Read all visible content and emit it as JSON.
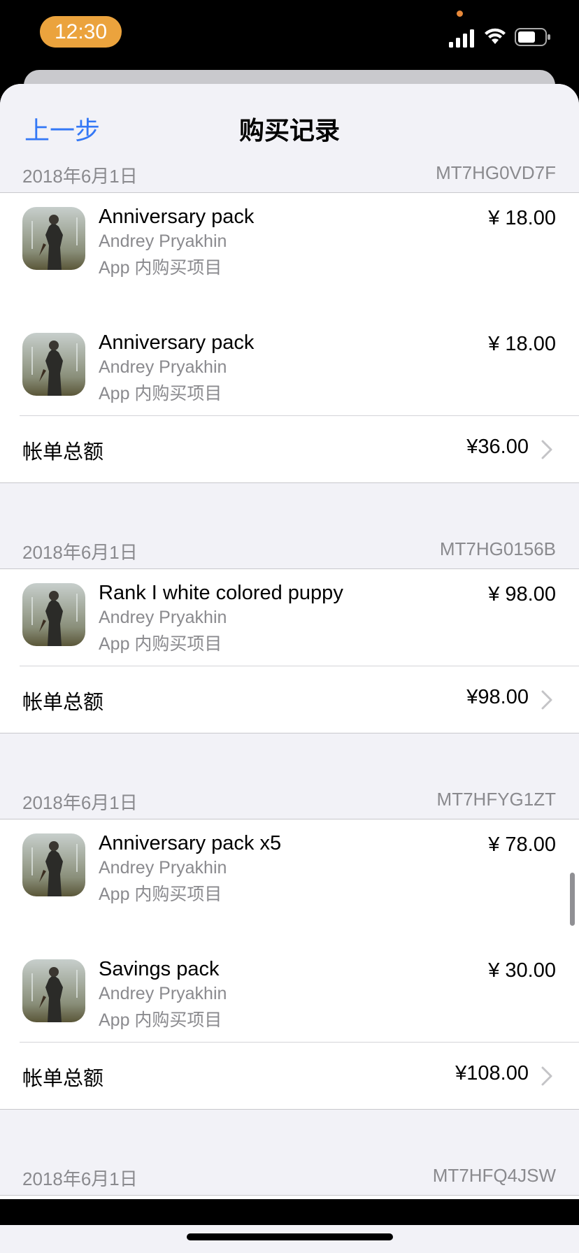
{
  "status_bar": {
    "time": "12:30"
  },
  "nav": {
    "back_label": "上一步",
    "title": "购买记录"
  },
  "icons": {
    "app_icon": "game-app-icon-survivor",
    "chevron": "chevron-right-icon"
  },
  "colors": {
    "accent": "#3478f6",
    "time_pill": "#eba33d",
    "secondary_text": "#8a8a8e"
  },
  "orders": [
    {
      "date": "2018年6月1日",
      "order_id": "MT7HG0VD7F",
      "items": [
        {
          "name": "Anniversary pack",
          "developer": "Andrey Pryakhin",
          "type": "App 内购买项目",
          "price": "¥ 18.00"
        },
        {
          "name": "Anniversary pack",
          "developer": "Andrey Pryakhin",
          "type": "App 内购买项目",
          "price": "¥ 18.00"
        }
      ],
      "total_label": "帐单总额",
      "total": "¥36.00"
    },
    {
      "date": "2018年6月1日",
      "order_id": "MT7HG0156B",
      "items": [
        {
          "name": "Rank I white colored puppy",
          "developer": "Andrey Pryakhin",
          "type": "App 内购买项目",
          "price": "¥ 98.00"
        }
      ],
      "total_label": "帐单总额",
      "total": "¥98.00"
    },
    {
      "date": "2018年6月1日",
      "order_id": "MT7HFYG1ZT",
      "items": [
        {
          "name": "Anniversary pack x5",
          "developer": "Andrey Pryakhin",
          "type": "App 内购买项目",
          "price": "¥ 78.00"
        },
        {
          "name": "Savings pack",
          "developer": "Andrey Pryakhin",
          "type": "App 内购买项目",
          "price": "¥ 30.00"
        }
      ],
      "total_label": "帐单总额",
      "total": "¥108.00"
    },
    {
      "date": "2018年6月1日",
      "order_id": "MT7HFQ4JSW",
      "items": [],
      "total_label": "",
      "total": ""
    }
  ]
}
